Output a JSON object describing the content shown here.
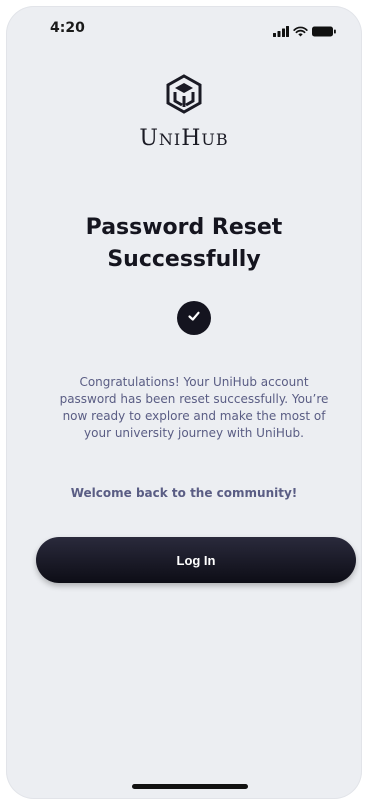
{
  "status_bar": {
    "time": "4:20",
    "icons": [
      "signal-icon",
      "wifi-icon",
      "battery-icon"
    ]
  },
  "brand": {
    "logo_icon": "unihub-cube-logo-icon",
    "name_first": "U",
    "name_mid": "NI",
    "name_h": "H",
    "name_end": "UB"
  },
  "main": {
    "title_line1": "Password Reset",
    "title_line2": "Successfully",
    "success_icon": "checkmark-icon",
    "message": "Congratulations! Your UniHub account password has been reset successfully. You’re now ready to explore and make the most of your university journey with UniHub.",
    "welcome": "Welcome back to the community!"
  },
  "actions": {
    "login_label": "Log In"
  },
  "colors": {
    "background": "#eceef2",
    "primary_dark": "#14141f",
    "muted_text": "#5a5d84"
  }
}
